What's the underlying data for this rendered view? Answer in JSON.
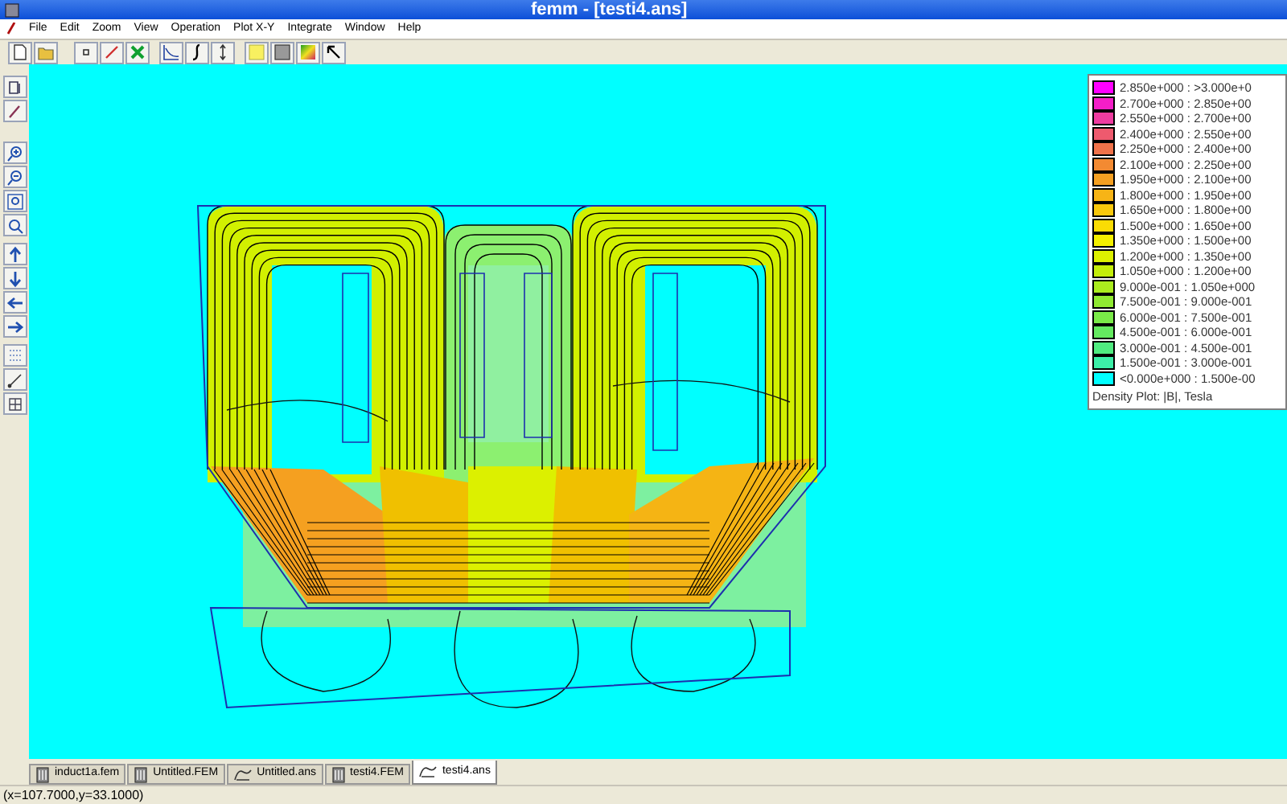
{
  "window": {
    "title": "femm - [testi4.ans]"
  },
  "menu": [
    "File",
    "Edit",
    "Zoom",
    "View",
    "Operation",
    "Plot X-Y",
    "Integrate",
    "Window",
    "Help"
  ],
  "legend": {
    "entries": [
      {
        "label": "2.850e+000 : >3.000e+0",
        "color": "#ff00ff"
      },
      {
        "label": "2.700e+000 : 2.850e+00",
        "color": "#f41ec8"
      },
      {
        "label": "2.550e+000 : 2.700e+00",
        "color": "#ee3ca0"
      },
      {
        "label": "2.400e+000 : 2.550e+00",
        "color": "#ee5a6e"
      },
      {
        "label": "2.250e+000 : 2.400e+00",
        "color": "#f0724a"
      },
      {
        "label": "2.100e+000 : 2.250e+00",
        "color": "#f38a32"
      },
      {
        "label": "1.950e+000 : 2.100e+00",
        "color": "#f5a022"
      },
      {
        "label": "1.800e+000 : 1.950e+00",
        "color": "#f7b416"
      },
      {
        "label": "1.650e+000 : 1.800e+00",
        "color": "#f8c80c"
      },
      {
        "label": "1.500e+000 : 1.650e+00",
        "color": "#fadc04"
      },
      {
        "label": "1.350e+000 : 1.500e+00",
        "color": "#f4f000"
      },
      {
        "label": "1.200e+000 : 1.350e+00",
        "color": "#dcf000"
      },
      {
        "label": "1.050e+000 : 1.200e+00",
        "color": "#c4ee0a"
      },
      {
        "label": "9.000e-001 : 1.050e+000",
        "color": "#aaec1e"
      },
      {
        "label": "7.500e-001 : 9.000e-001",
        "color": "#90ea32"
      },
      {
        "label": "6.000e-001 : 7.500e-001",
        "color": "#7aea48"
      },
      {
        "label": "4.500e-001 : 6.000e-001",
        "color": "#64ea60"
      },
      {
        "label": "3.000e-001 : 4.500e-001",
        "color": "#50ec80"
      },
      {
        "label": "1.500e-001 : 3.000e-001",
        "color": "#3cf0a8"
      },
      {
        "label": "<0.000e+000 : 1.500e-00",
        "color": "#00ffff"
      }
    ],
    "caption": "Density Plot: |B|, Tesla"
  },
  "tabs": [
    {
      "label": "induct1a.fem",
      "kind": "fem",
      "selected": false
    },
    {
      "label": "Untitled.FEM",
      "kind": "fem",
      "selected": false
    },
    {
      "label": "Untitled.ans",
      "kind": "ans",
      "selected": false
    },
    {
      "label": "testi4.FEM",
      "kind": "fem",
      "selected": false
    },
    {
      "label": "testi4.ans",
      "kind": "ans",
      "selected": true
    }
  ],
  "status_bar": "(x=107.7000,y=33.1000)"
}
